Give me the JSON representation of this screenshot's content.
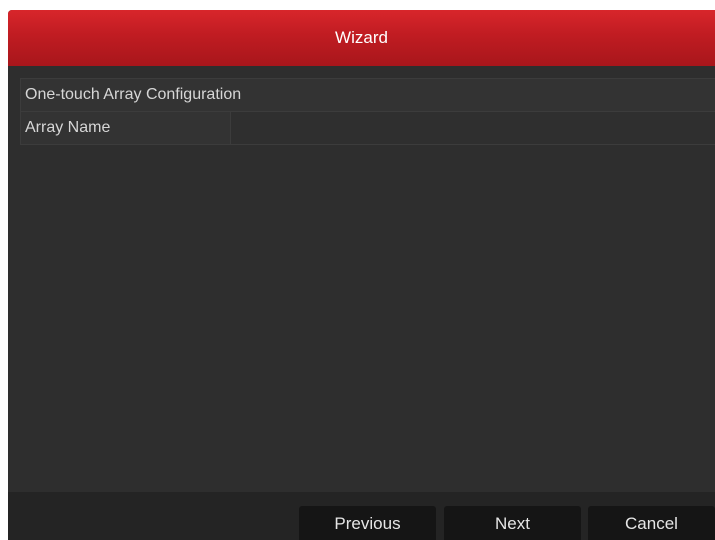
{
  "window": {
    "title": "Wizard"
  },
  "config": {
    "section_header": "One-touch Array Configuration",
    "array_name_label": "Array Name",
    "array_name_value": ""
  },
  "footer": {
    "previous_label": "Previous",
    "next_label": "Next",
    "cancel_label": "Cancel"
  },
  "colors": {
    "title_bar": "#c01c22",
    "background": "#2e2e2e",
    "button": "#151515",
    "text": "#d6d6d6"
  }
}
